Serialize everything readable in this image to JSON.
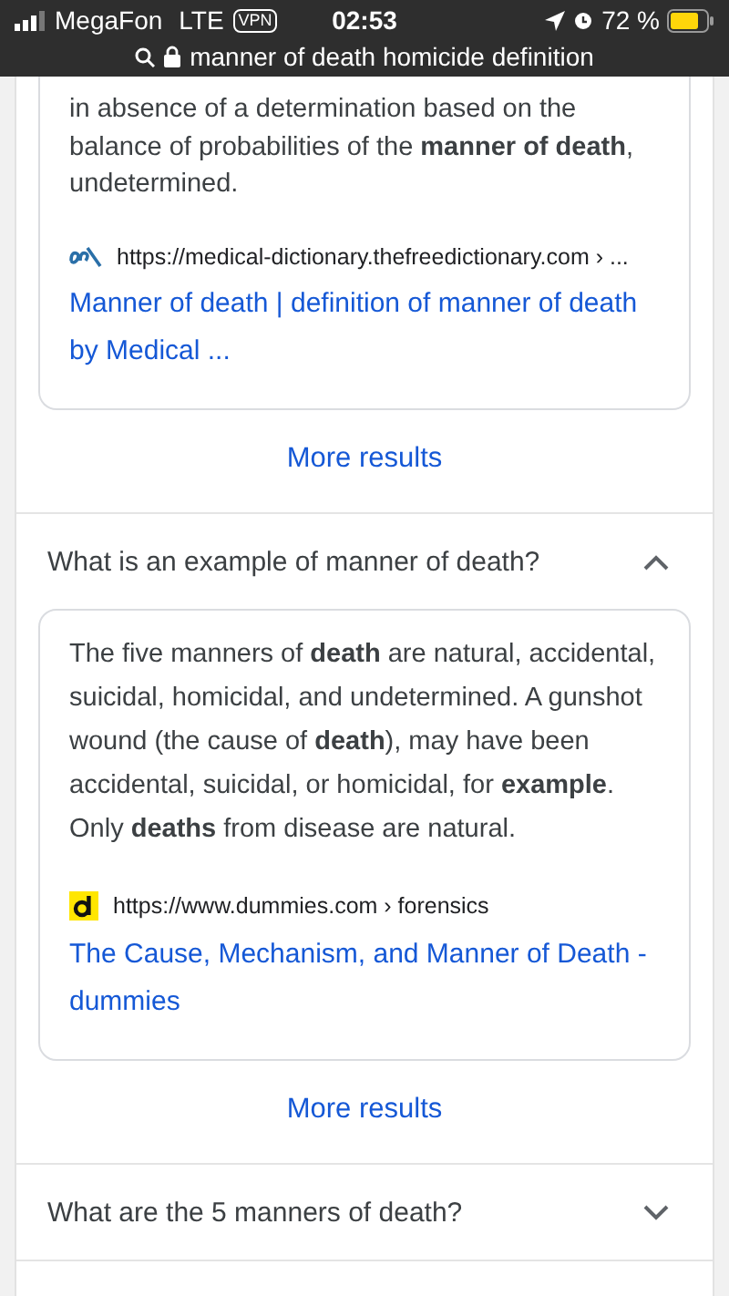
{
  "status_bar": {
    "carrier": "MegaFon",
    "network": "LTE",
    "vpn": "VPN",
    "time": "02:53",
    "battery": "72 %"
  },
  "address_bar": {
    "query": "manner of death homicide definition"
  },
  "top_result": {
    "snippet": "in absence of a determination based on the balance of probabilities of the **manner of death**, undetermined.",
    "source_url": "https://medical-dictionary.thefreedictionary.com › ...",
    "title": "Manner of death | definition of manner of death by Medical ...",
    "more_link": "More results"
  },
  "questions": [
    {
      "question": "What is an example of manner of death?",
      "expanded": true,
      "snippet": "The five manners of **death** are natural, accidental, suicidal, homicidal, and undetermined. A gunshot wound (the cause of **death**), may have been accidental, suicidal, or homicidal, for **example**. Only **deaths** from disease are natural.",
      "source_url": "https://www.dummies.com › forensics",
      "title": "The Cause, Mechanism, and Manner of Death - dummies",
      "more_link": "More results"
    },
    {
      "question": "What are the 5 manners of death?",
      "expanded": false
    }
  ]
}
